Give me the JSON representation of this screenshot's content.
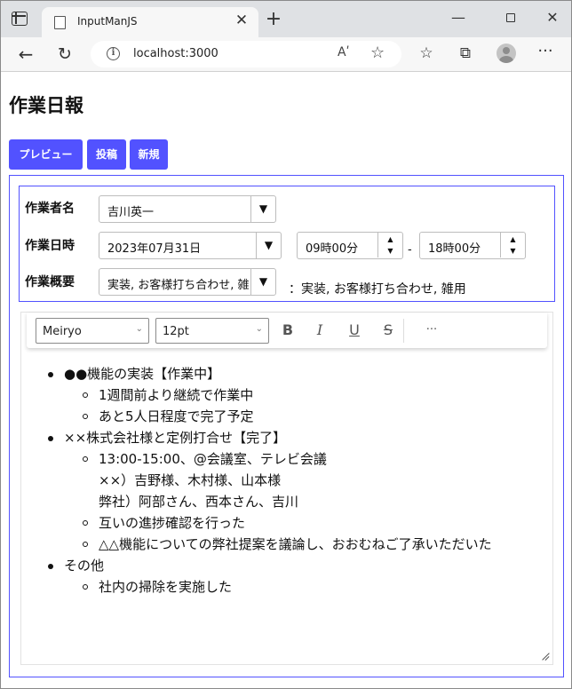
{
  "browser": {
    "tab_title": "InputManJS",
    "tab_close": "✕",
    "new_tab": "+",
    "url": "localhost:3000",
    "read_aloud": "Aʹ",
    "minimize": "—",
    "close": "✕"
  },
  "page": {
    "title": "作業日報",
    "buttons": {
      "preview": "プレビュー",
      "post": "投稿",
      "new": "新規"
    },
    "accent": "#5252ff"
  },
  "form": {
    "worker_label": "作業者名",
    "worker_value": "吉川英一",
    "date_label": "作業日時",
    "date_value": "2023年07月31日",
    "start_time": "09時00分",
    "end_time": "18時00分",
    "range_sep": "-",
    "summary_label": "作業概要",
    "summary_value": "実装, お客様打ち合わせ, 雑用",
    "summary_echo": "：実装, お客様打ち合わせ, 雑用"
  },
  "editor": {
    "font": "Meiryo",
    "size": "12pt",
    "bold": "B",
    "italic": "I",
    "underline": "U",
    "strike": "S",
    "more": "···",
    "items": [
      {
        "text": "●●機能の実装【作業中】",
        "children": [
          "1週間前より継続で作業中",
          "あと5人日程度で完了予定"
        ]
      },
      {
        "text": "××株式会社様と定例打合せ【完了】",
        "children": [
          [
            "13:00-15:00、@会議室、テレビ会議",
            "××）吉野様、木村様、山本様",
            "弊社）阿部さん、西本さん、吉川"
          ],
          "互いの進捗確認を行った",
          "△△機能についての弊社提案を議論し、おおむねご了承いただいた"
        ]
      },
      {
        "text": "その他",
        "children": [
          "社内の掃除を実施した"
        ]
      }
    ]
  }
}
